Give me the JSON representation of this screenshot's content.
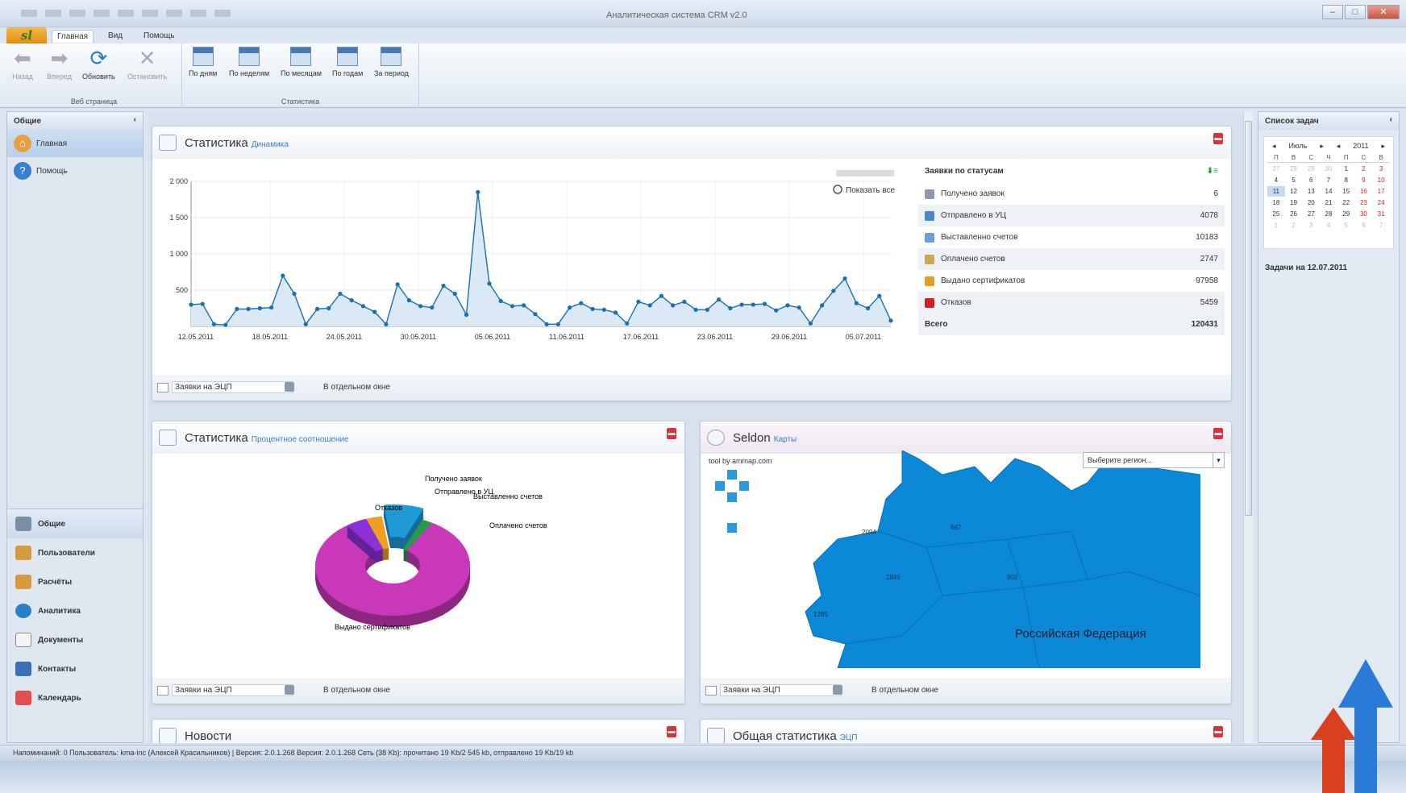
{
  "window": {
    "title": "Аналитическая система CRM v2.0"
  },
  "ribbon": {
    "tabs": [
      "Главная",
      "Вид",
      "Помощь"
    ],
    "web_group": {
      "label": "Веб страница",
      "buttons": [
        "Назад",
        "Вперед",
        "Обновить",
        "Остановить"
      ]
    },
    "stats_group": {
      "label": "Статистика",
      "buttons": [
        "По дням",
        "По неделям",
        "По месяцам",
        "По годам",
        "За период"
      ]
    }
  },
  "left_pane": {
    "title": "Общие",
    "items": [
      "Главная",
      "Помощь"
    ],
    "bottom_nav": [
      "Общие",
      "Пользователи",
      "Расчёты",
      "Аналитика",
      "Документы",
      "Контакты",
      "Календарь"
    ]
  },
  "panel_dynamics": {
    "title": "Статистика",
    "subtitle": "Динамика",
    "show_all": "Показать все",
    "footer_select": "Заявки на ЭЦП",
    "footer_link": "В отдельном окне",
    "status_table": {
      "header": "Заявки по статусам",
      "rows": [
        {
          "label": "Получено заявок",
          "value": "6",
          "color": "#8a9bb0"
        },
        {
          "label": "Отправлено в УЦ",
          "value": "4078",
          "color": "#4a86c8"
        },
        {
          "label": "Выставленно счетов",
          "value": "10183",
          "color": "#6aa0d8"
        },
        {
          "label": "Оплачено счетов",
          "value": "2747",
          "color": "#c8a850"
        },
        {
          "label": "Выдано сертификатов",
          "value": "97958",
          "color": "#e0a020"
        },
        {
          "label": "Отказов",
          "value": "5459",
          "color": "#d02020"
        }
      ],
      "total_label": "Всего",
      "total_value": "120431"
    }
  },
  "chart_data": [
    {
      "type": "area",
      "title": "",
      "ylim": [
        0,
        2000
      ],
      "yticks": [
        "2 000",
        "1 500",
        "1 000",
        "500"
      ],
      "xticks": [
        "12.05.2011",
        "18.05.2011",
        "24.05.2011",
        "30.05.2011",
        "05.06.2011",
        "11.06.2011",
        "17.06.2011",
        "23.06.2011",
        "29.06.2011",
        "05.07.2011"
      ],
      "values": [
        300,
        310,
        30,
        20,
        240,
        240,
        250,
        260,
        700,
        450,
        30,
        240,
        250,
        450,
        360,
        280,
        200,
        30,
        580,
        360,
        280,
        260,
        560,
        450,
        160,
        1850,
        590,
        350,
        280,
        290,
        170,
        30,
        30,
        260,
        320,
        240,
        230,
        190,
        40,
        340,
        290,
        420,
        290,
        340,
        230,
        230,
        370,
        250,
        300,
        300,
        310,
        220,
        290,
        260,
        40,
        290,
        490,
        660,
        320,
        250,
        420,
        80
      ],
      "color": "#1a6fb5"
    },
    {
      "type": "pie",
      "labels": [
        "Получено заявок",
        "Отправлено в УЦ",
        "Выставленно счетов",
        "Оплачено счетов",
        "Выдано сертификатов",
        "Отказов"
      ],
      "values": [
        6,
        4078,
        10183,
        2747,
        97958,
        5459
      ],
      "colors": [
        "#8aa0b8",
        "#f0a020",
        "#1f9ad6",
        "#2a9a4a",
        "#c838b8",
        "#8c30d8"
      ]
    }
  ],
  "panel_percent": {
    "title": "Статистика",
    "subtitle": "Процентное соотношение",
    "footer_select": "Заявки на ЭЦП",
    "footer_link": "В отдельном окне",
    "labels": {
      "received": "Получено заявок",
      "sent": "Отправлено в УЦ",
      "invoiced": "Выставленно счетов",
      "paid": "Оплачено счетов",
      "refused": "Отказов",
      "issued": "Выдано сертификатов"
    }
  },
  "panel_map": {
    "title": "Seldon",
    "subtitle": "Карты",
    "credit": "tool by ammap.com",
    "region_placeholder": "Выберите регион...",
    "country_label": "Российская Федерация",
    "footer_select": "Заявки на ЭЦП",
    "footer_link": "В отдельном окне",
    "region_values": [
      "2094",
      "667",
      "2845",
      "902",
      "1285"
    ]
  },
  "panel_news": {
    "title": "Новости"
  },
  "panel_general": {
    "title": "Общая статистика",
    "subtitle": "ЭЦП"
  },
  "right_pane": {
    "title": "Список задач",
    "calendar": {
      "month": "Июль",
      "year": "2011",
      "weekdays": [
        "П",
        "В",
        "С",
        "Ч",
        "П",
        "С",
        "В"
      ]
    },
    "tasks_label": "Задачи на 12.07.2011"
  },
  "statusbar": {
    "text": "Напоминаний: 0    Пользователь: kma-inc (Алексей Красильников) | Версия: 2.0.1.268    Версия: 2.0.1.268    Сеть (38 Kb): прочитано 19 Kb/2 545 kb, отправлено 19 Kb/19 kb"
  }
}
